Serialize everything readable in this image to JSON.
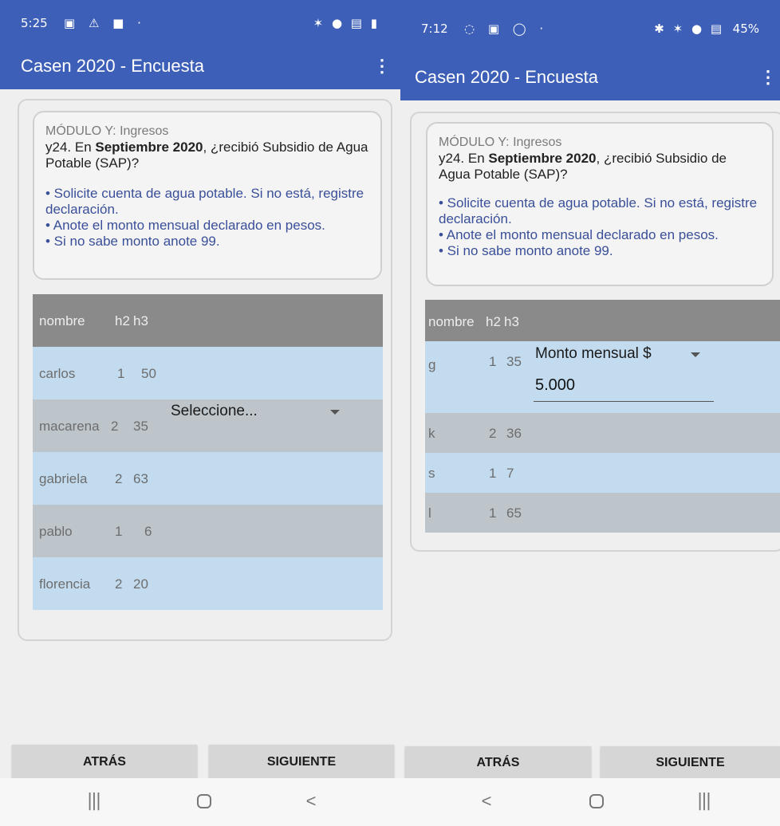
{
  "left": {
    "status": {
      "time": "5:25",
      "left_icons": "▣ ⚠ ■ ·",
      "right_icons": "✶ ● ▤ ▮"
    },
    "app": {
      "title": "Casen 2020 - Encuesta",
      "menu_icon": "⋮"
    },
    "question": {
      "module": "MÓDULO Y: Ingresos",
      "q_prefix": "y24. En ",
      "q_bold": "Septiembre 2020",
      "q_suffix": ", ¿recibió Subsidio de Agua Potable (SAP)?",
      "instr1": "• Solicite cuenta de agua potable. Si no está, registre declaración.",
      "instr2": "• Anote el monto mensual declarado en pesos.",
      "instr3": "• Si no sabe monto anote 99."
    },
    "table": {
      "headers": [
        "nombre",
        "h2",
        "h3"
      ],
      "rows": [
        [
          "carlos",
          "1",
          "50"
        ],
        [
          "macarena",
          "2",
          "35"
        ],
        [
          "gabriela",
          "2",
          "63"
        ],
        [
          "pablo",
          "1",
          "6"
        ],
        [
          "florencia",
          "2",
          "20"
        ]
      ]
    },
    "dropdown": {
      "label": "Seleccione..."
    },
    "buttons": {
      "back": "ATRÁS",
      "next": "SIGUIENTE"
    },
    "nav": {
      "recents": "|||",
      "home": "",
      "back": "<"
    }
  },
  "right": {
    "status": {
      "time": "7:12",
      "left_icons": "◌ ▣ ◯ ·",
      "right_icons": "✱ ✶ ● ▤",
      "battery": "45%"
    },
    "app": {
      "title": "Casen 2020 - Encuesta",
      "menu_icon": "⋮"
    },
    "question": {
      "module": "MÓDULO Y: Ingresos",
      "q_prefix": "y24. En ",
      "q_bold": "Septiembre 2020",
      "q_suffix": ", ¿recibió Subsidio de Agua Potable (SAP)?",
      "instr1": "• Solicite cuenta de agua potable. Si no está, registre declaración.",
      "instr2": "• Anote el monto mensual declarado en pesos.",
      "instr3": "• Si no sabe monto anote 99."
    },
    "table": {
      "headers": [
        "nombre",
        "h2",
        "h3"
      ],
      "rows": [
        [
          "g",
          "1",
          "35"
        ],
        [
          "k",
          "2",
          "36"
        ],
        [
          "s",
          "1",
          "7"
        ],
        [
          "l",
          "1",
          "65"
        ]
      ]
    },
    "dropdown": {
      "label": "Monto mensual $"
    },
    "amount": {
      "value": "5.000"
    },
    "buttons": {
      "back": "ATRÁS",
      "next": "SIGUIENTE"
    },
    "nav": {
      "back": "<",
      "home": "",
      "recents": "|||"
    }
  },
  "colors": {
    "appbar": "#3d5fb8",
    "row_blue": "#c2dbef",
    "row_grey": "#bdc4ca",
    "header_row": "#8a8a8a",
    "instruction_text": "#3a4f99"
  }
}
